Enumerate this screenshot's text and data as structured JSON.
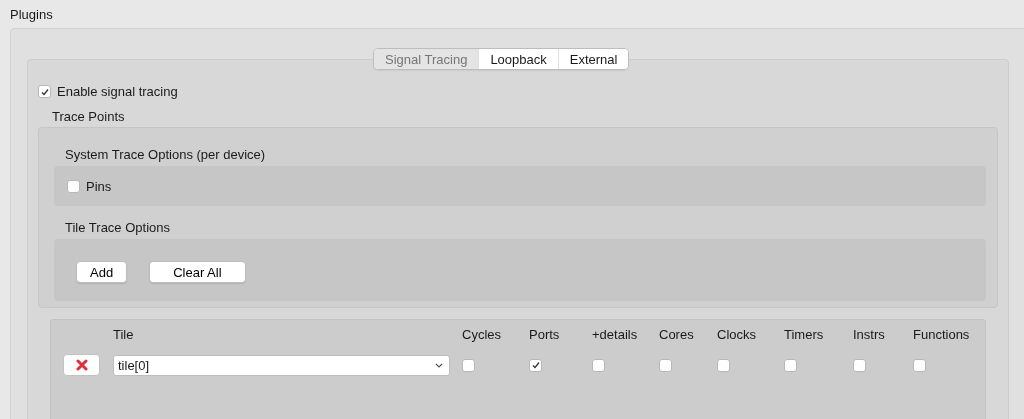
{
  "panel_title": "Plugins",
  "tabs": [
    {
      "label": "Signal Tracing",
      "selected": true
    },
    {
      "label": "Loopback",
      "selected": false
    },
    {
      "label": "External",
      "selected": false
    }
  ],
  "enable": {
    "label": "Enable signal tracing",
    "checked": true
  },
  "trace_points": {
    "title": "Trace Points",
    "system": {
      "title": "System Trace Options (per device)",
      "options": [
        {
          "label": "Pins",
          "checked": false
        }
      ]
    },
    "tile": {
      "title": "Tile Trace Options",
      "buttons": [
        "Add",
        "Clear All"
      ]
    }
  },
  "table": {
    "columns": [
      "Tile",
      "Cycles",
      "Ports",
      "+details",
      "Cores",
      "Clocks",
      "Timers",
      "Instrs",
      "Functions"
    ],
    "rows": [
      {
        "tile": "tile[0]",
        "flags": [
          false,
          true,
          false,
          false,
          false,
          false,
          false,
          false
        ]
      }
    ]
  }
}
